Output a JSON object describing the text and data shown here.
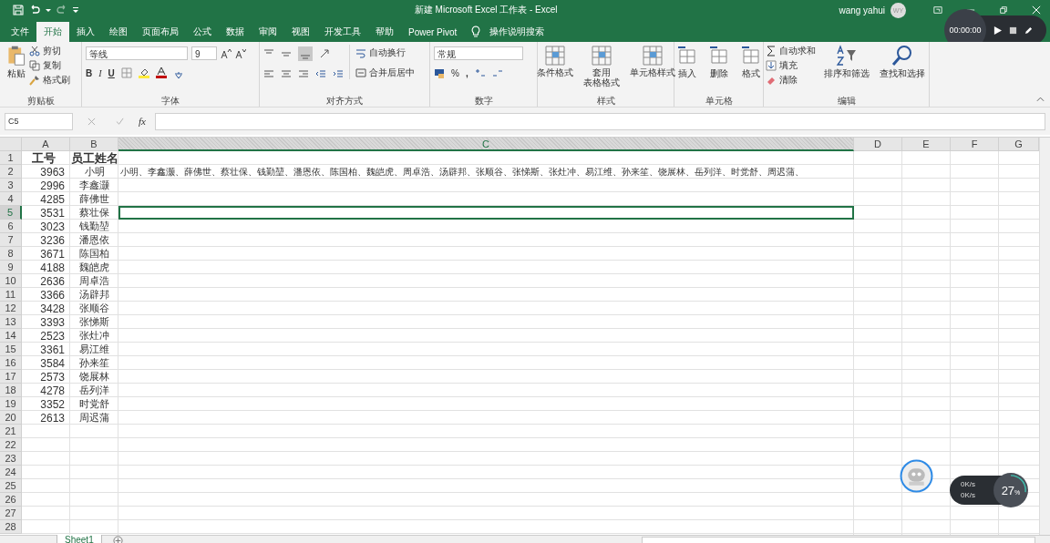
{
  "title_bar": {
    "title": "新建 Microsoft Excel 工作表  -  Excel",
    "user": "wang yahui",
    "initials": "WY"
  },
  "recorder": {
    "time": "00:00:00"
  },
  "tabs": [
    {
      "label": "文件",
      "selected": false
    },
    {
      "label": "开始",
      "selected": true
    },
    {
      "label": "插入",
      "selected": false
    },
    {
      "label": "绘图",
      "selected": false
    },
    {
      "label": "页面布局",
      "selected": false
    },
    {
      "label": "公式",
      "selected": false
    },
    {
      "label": "数据",
      "selected": false
    },
    {
      "label": "审阅",
      "selected": false
    },
    {
      "label": "视图",
      "selected": false
    },
    {
      "label": "开发工具",
      "selected": false
    },
    {
      "label": "帮助",
      "selected": false
    },
    {
      "label": "Power Pivot",
      "selected": false
    }
  ],
  "tell_me": "操作说明搜索",
  "ribbon": {
    "clipboard": {
      "label": "剪贴板",
      "paste": "粘贴",
      "cut": "剪切",
      "copy": "复制",
      "painter": "格式刷"
    },
    "font": {
      "label": "字体",
      "font_name": "等线",
      "font_size": "9",
      "bold": "B",
      "italic": "I",
      "underline": "U"
    },
    "alignment": {
      "label": "对齐方式",
      "wrap": "自动换行",
      "merge": "合并后居中"
    },
    "number": {
      "label": "数字",
      "format": "常规",
      "percent": "%",
      "comma": ","
    },
    "styles": {
      "label": "样式",
      "buttons": [
        {
          "lines": [
            "条件格式"
          ]
        },
        {
          "lines": [
            "套用",
            "表格格式"
          ]
        },
        {
          "lines": [
            "单元格样式"
          ]
        }
      ]
    },
    "cells": {
      "label": "单元格",
      "buttons": [
        "插入",
        "删除",
        "格式"
      ]
    },
    "editing": {
      "label": "编辑",
      "autosum": "自动求和",
      "fill": "填充",
      "clear": "清除",
      "sort": "排序和筛选",
      "find": "查找和选择"
    }
  },
  "formula_bar": {
    "name_box": "C5",
    "fx": "fx"
  },
  "sheet": {
    "columns": [
      {
        "label": "A",
        "selected": false
      },
      {
        "label": "B",
        "selected": false
      },
      {
        "label": "C",
        "selected": true
      },
      {
        "label": "D",
        "selected": false
      },
      {
        "label": "E",
        "selected": false
      },
      {
        "label": "F",
        "selected": false
      },
      {
        "label": "G",
        "selected": false
      }
    ],
    "rows": [
      {
        "number": "1",
        "selected": false,
        "header": true,
        "a": "工号",
        "b": "员工姓名"
      },
      {
        "number": "2",
        "selected": false,
        "a": "3963",
        "b": "小明",
        "c": "小明、李鑫灏、薛佛世、蔡壮保、钱勤堃、潘恩依、陈国柏、魏皑虎、周卓浩、汤辟邦、张顺谷、张悌斯、张灶冲、易江维、孙来笙、饶展林、岳列洋、时党舒、周迟蒲、"
      },
      {
        "number": "3",
        "selected": false,
        "a": "2996",
        "b": "李鑫灏"
      },
      {
        "number": "4",
        "selected": false,
        "a": "4285",
        "b": "薛佛世"
      },
      {
        "number": "5",
        "selected": true,
        "a": "3531",
        "b": "蔡壮保"
      },
      {
        "number": "6",
        "selected": false,
        "a": "3023",
        "b": "钱勤堃"
      },
      {
        "number": "7",
        "selected": false,
        "a": "3236",
        "b": "潘恩依"
      },
      {
        "number": "8",
        "selected": false,
        "a": "3671",
        "b": "陈国柏"
      },
      {
        "number": "9",
        "selected": false,
        "a": "4188",
        "b": "魏皑虎"
      },
      {
        "number": "10",
        "selected": false,
        "a": "2636",
        "b": "周卓浩"
      },
      {
        "number": "11",
        "selected": false,
        "a": "3366",
        "b": "汤辟邦"
      },
      {
        "number": "12",
        "selected": false,
        "a": "3428",
        "b": "张顺谷"
      },
      {
        "number": "13",
        "selected": false,
        "a": "3393",
        "b": "张悌斯"
      },
      {
        "number": "14",
        "selected": false,
        "a": "2523",
        "b": "张灶冲"
      },
      {
        "number": "15",
        "selected": false,
        "a": "3361",
        "b": "易江维"
      },
      {
        "number": "16",
        "selected": false,
        "a": "3584",
        "b": "孙来笙"
      },
      {
        "number": "17",
        "selected": false,
        "a": "2573",
        "b": "饶展林"
      },
      {
        "number": "18",
        "selected": false,
        "a": "4278",
        "b": "岳列洋"
      },
      {
        "number": "19",
        "selected": false,
        "a": "3352",
        "b": "时党舒"
      },
      {
        "number": "20",
        "selected": false,
        "a": "2613",
        "b": "周迟蒲"
      },
      {
        "number": "21",
        "selected": false
      },
      {
        "number": "22",
        "selected": false
      },
      {
        "number": "23",
        "selected": false
      },
      {
        "number": "24",
        "selected": false
      },
      {
        "number": "25",
        "selected": false
      },
      {
        "number": "26",
        "selected": false
      },
      {
        "number": "27",
        "selected": false
      },
      {
        "number": "28",
        "selected": false
      }
    ]
  },
  "sheet_tabs": [
    {
      "label": "Sheet1",
      "selected": true
    }
  ],
  "network_widget": {
    "upload": "0K/s",
    "download": "0K/s",
    "cpu": "27",
    "unit": "%",
    "level": 0.27
  }
}
